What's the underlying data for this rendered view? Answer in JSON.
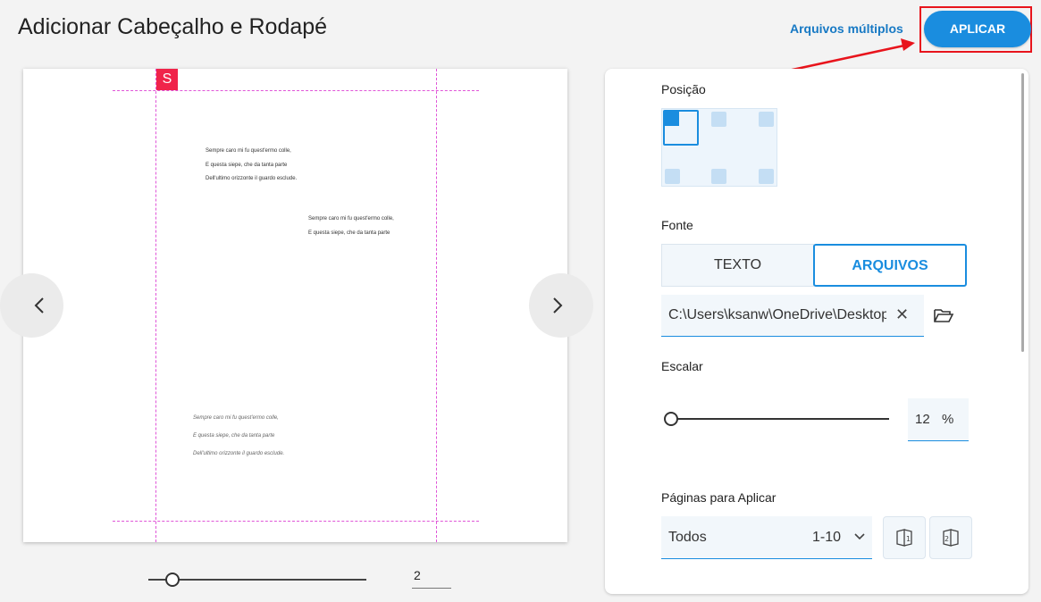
{
  "header": {
    "title": "Adicionar Cabeçalho e Rodapé",
    "multiple_files_link": "Arquivos múltiplos",
    "apply_button": "APLICAR"
  },
  "preview": {
    "badge": "S",
    "upper_text": [
      "Sempre caro mi fu quest'ermo colle,",
      "E questa siepe, che da tanta parte",
      "Dell'ultimo orizzonte il guardo esclude."
    ],
    "middle_text": [
      "Sempre caro mi fu quest'ermo colle,",
      "E questa siepe, che da tanta parte"
    ],
    "lower_text": [
      "Sempre caro mi fu quest'ermo colle,",
      "E questa siepe, che da tanta parte",
      "Dell'ultimo orizzonte il guardo esclude."
    ],
    "prev_icon": "chevron-left-icon",
    "next_icon": "chevron-right-icon"
  },
  "page_slider": {
    "value": 2,
    "position_fraction": 0.11,
    "page_field": "2"
  },
  "settings": {
    "position": {
      "label": "Posição",
      "selected": "top-left"
    },
    "font": {
      "label": "Fonte",
      "tabs": [
        "TEXTO",
        "ARQUIVOS"
      ],
      "active_tab": "ARQUIVOS",
      "path_value": "C:\\Users\\ksanw\\OneDrive\\Desktop",
      "clear_icon": "close-icon",
      "folder_icon": "folder-open-icon"
    },
    "scale": {
      "label": "Escalar",
      "value": "12",
      "unit": "%",
      "fraction": 0.0
    },
    "pages": {
      "label": "Páginas para Aplicar",
      "selected": "Todos",
      "range": "1-10",
      "odd_icon": "odd-pages-icon",
      "even_icon": "even-pages-icon"
    }
  },
  "colors": {
    "accent": "#1a8ddf",
    "highlight_box": "#e8141c",
    "guide": "#e055d8",
    "badge": "#f0244a"
  }
}
